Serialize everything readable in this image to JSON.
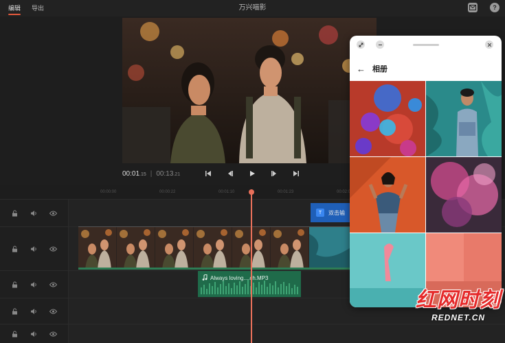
{
  "topbar": {
    "tabs": [
      "编辑",
      "导出"
    ],
    "title": "万兴喵影",
    "icons": [
      "mail-icon",
      "help-icon"
    ],
    "help_glyph": "?"
  },
  "player": {
    "current_time": "00:01",
    "current_frames": ".15",
    "total_time": "00:13",
    "total_frames": ".21",
    "separator": "|"
  },
  "ruler": {
    "ticks": [
      "00:00:00",
      "00:00:22",
      "00:01:10",
      "00:01:23",
      "00:02:00"
    ]
  },
  "timeline": {
    "text_clip": {
      "badge": "T",
      "label": "双击输"
    },
    "audio_clip": {
      "label": "Always loving....ch.MP3"
    }
  },
  "album": {
    "title": "相册",
    "back_glyph": "←"
  },
  "watermark": {
    "main": "红网时刻",
    "sub": "REDNET.CN"
  },
  "colors": {
    "accent": "#e55a3c",
    "playhead": "#e8705a",
    "text_clip": "#1f5fb8",
    "audio_clip": "#1f6b4a"
  }
}
